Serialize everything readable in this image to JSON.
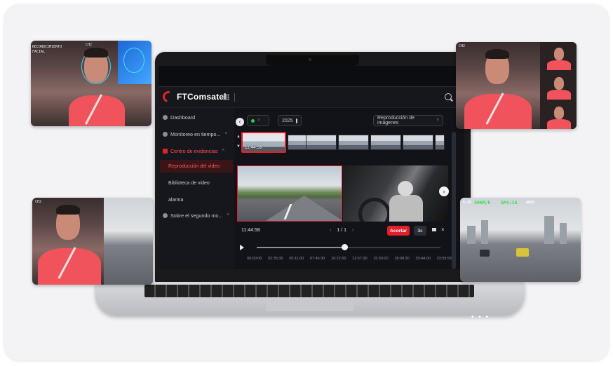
{
  "app": {
    "brand": "FTComsatel"
  },
  "sidebar": {
    "items": [
      {
        "label": "Dashboard",
        "caret": ""
      },
      {
        "label": "Monitoreo en tiempo...",
        "caret": "˅"
      },
      {
        "label": "Centro de evidencias",
        "caret": "˄"
      },
      {
        "label": "Reproducción del video"
      },
      {
        "label": "Biblioteca de video"
      },
      {
        "label": "alarma"
      },
      {
        "label": "Sobre el segundo mo...",
        "caret": "˅"
      }
    ]
  },
  "toolbar": {
    "back_glyph": "‹",
    "status_value": "",
    "date_value": "2025",
    "mode_value": "Reproducción de imágenes"
  },
  "player": {
    "thumb_time": "11:44:58",
    "current_time": "11:44:58",
    "page": "1 / 1",
    "prev_glyph": "‹",
    "next_glyph": "›",
    "cut_label": "Acortar",
    "speed_label": "3s",
    "close_glyph": "×",
    "next_btn_glyph": "›",
    "up_glyph": "▲",
    "down_glyph": "▼",
    "progress": 0.48,
    "ticks": [
      "00:00:00",
      "02:35:30",
      "05:11:00",
      "07:46:30",
      "10:22:00",
      "12:57:30",
      "15:33:00",
      "18:08:30",
      "20:44:00",
      "23:59:59"
    ]
  },
  "cards": {
    "face": {
      "ch_label": "CH2",
      "recog_label": "RECONOCIMIENTO\nFACIAL"
    },
    "dashcam": {
      "speed": "48KM/h",
      "gps": "GPS:16",
      "adas": "ADAS",
      "ch_label": "CH2"
    }
  },
  "decor": {
    "dots": "• • •"
  }
}
